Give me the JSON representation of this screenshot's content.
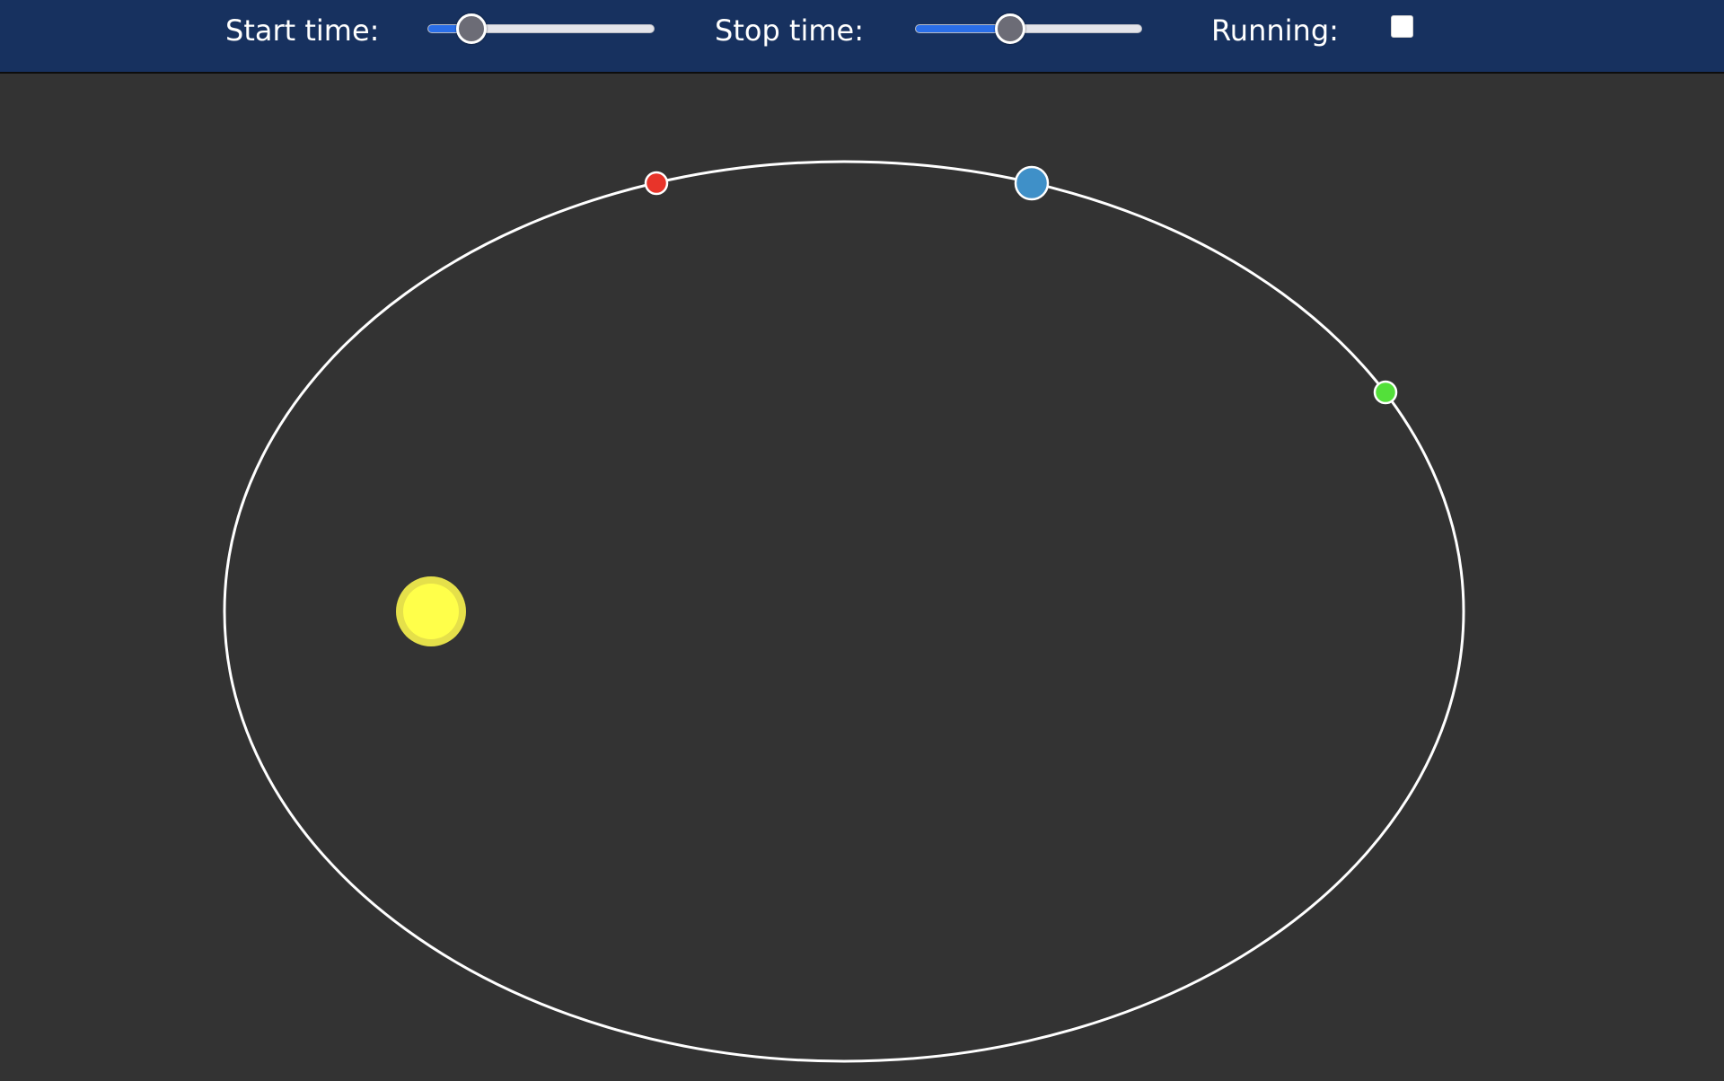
{
  "controls": {
    "start_time": {
      "label": "Start time:",
      "value": 0.19
    },
    "stop_time": {
      "label": "Stop time:",
      "value": 0.42
    },
    "running": {
      "label": "Running:",
      "checked": false
    }
  },
  "colors": {
    "toolbar_bg": "#17315f",
    "canvas_bg": "#333333",
    "orbit": "#ffffff",
    "sun_fill": "#ffff4a",
    "sun_ring": "#e5e04a",
    "start_marker": "#e8342a",
    "stop_marker": "#53e03a",
    "planet": "#3f90c8",
    "slider_track": "#e4e4ea",
    "slider_fill": "#2a6ee8",
    "slider_thumb": "#6c6c76"
  },
  "scene": {
    "orbit_shape": "ellipse",
    "sun_position": "left focus of the orbit",
    "start_marker_icon": "red-dot-icon",
    "stop_marker_icon": "green-dot-icon",
    "planet_icon": "blue-planet-icon",
    "sun_icon": "sun-icon"
  }
}
